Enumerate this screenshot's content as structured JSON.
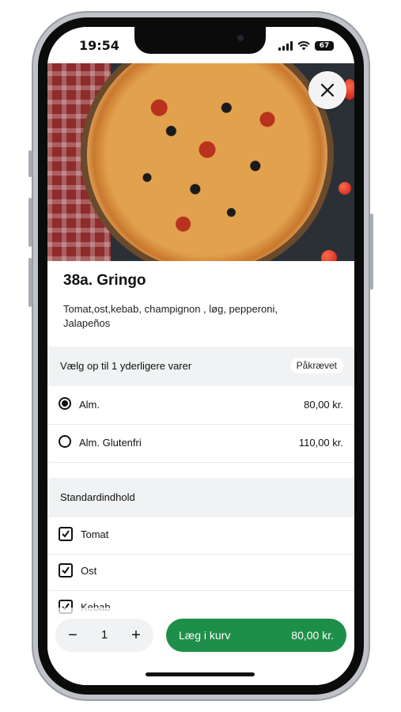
{
  "status_bar": {
    "time": "19:54",
    "battery": "67",
    "icons": [
      "signal-icon",
      "wifi-icon",
      "battery-icon"
    ]
  },
  "product": {
    "title": "38a. Gringo",
    "description": "Tomat,ost,kebab, champignon , løg, pepperoni, Jalapeños"
  },
  "options_section": {
    "title": "Vælg op til 1 yderligere varer",
    "badge": "Påkrævet",
    "options": [
      {
        "label": "Alm.",
        "price": "80,00 kr.",
        "selected": true
      },
      {
        "label": "Alm. Glutenfri",
        "price": "110,00 kr.",
        "selected": false
      }
    ]
  },
  "standard_section": {
    "title": "Standardindhold",
    "items": [
      {
        "label": "Tomat",
        "checked": true
      },
      {
        "label": "Ost",
        "checked": true
      },
      {
        "label": "Kebab",
        "checked": true
      }
    ]
  },
  "cart_bar": {
    "minus": "−",
    "quantity": "1",
    "plus": "+",
    "add_label": "Læg i kurv",
    "add_price": "80,00 kr."
  },
  "colors": {
    "accent_green": "#1e8f4a",
    "section_bg": "#f0f2f3"
  }
}
